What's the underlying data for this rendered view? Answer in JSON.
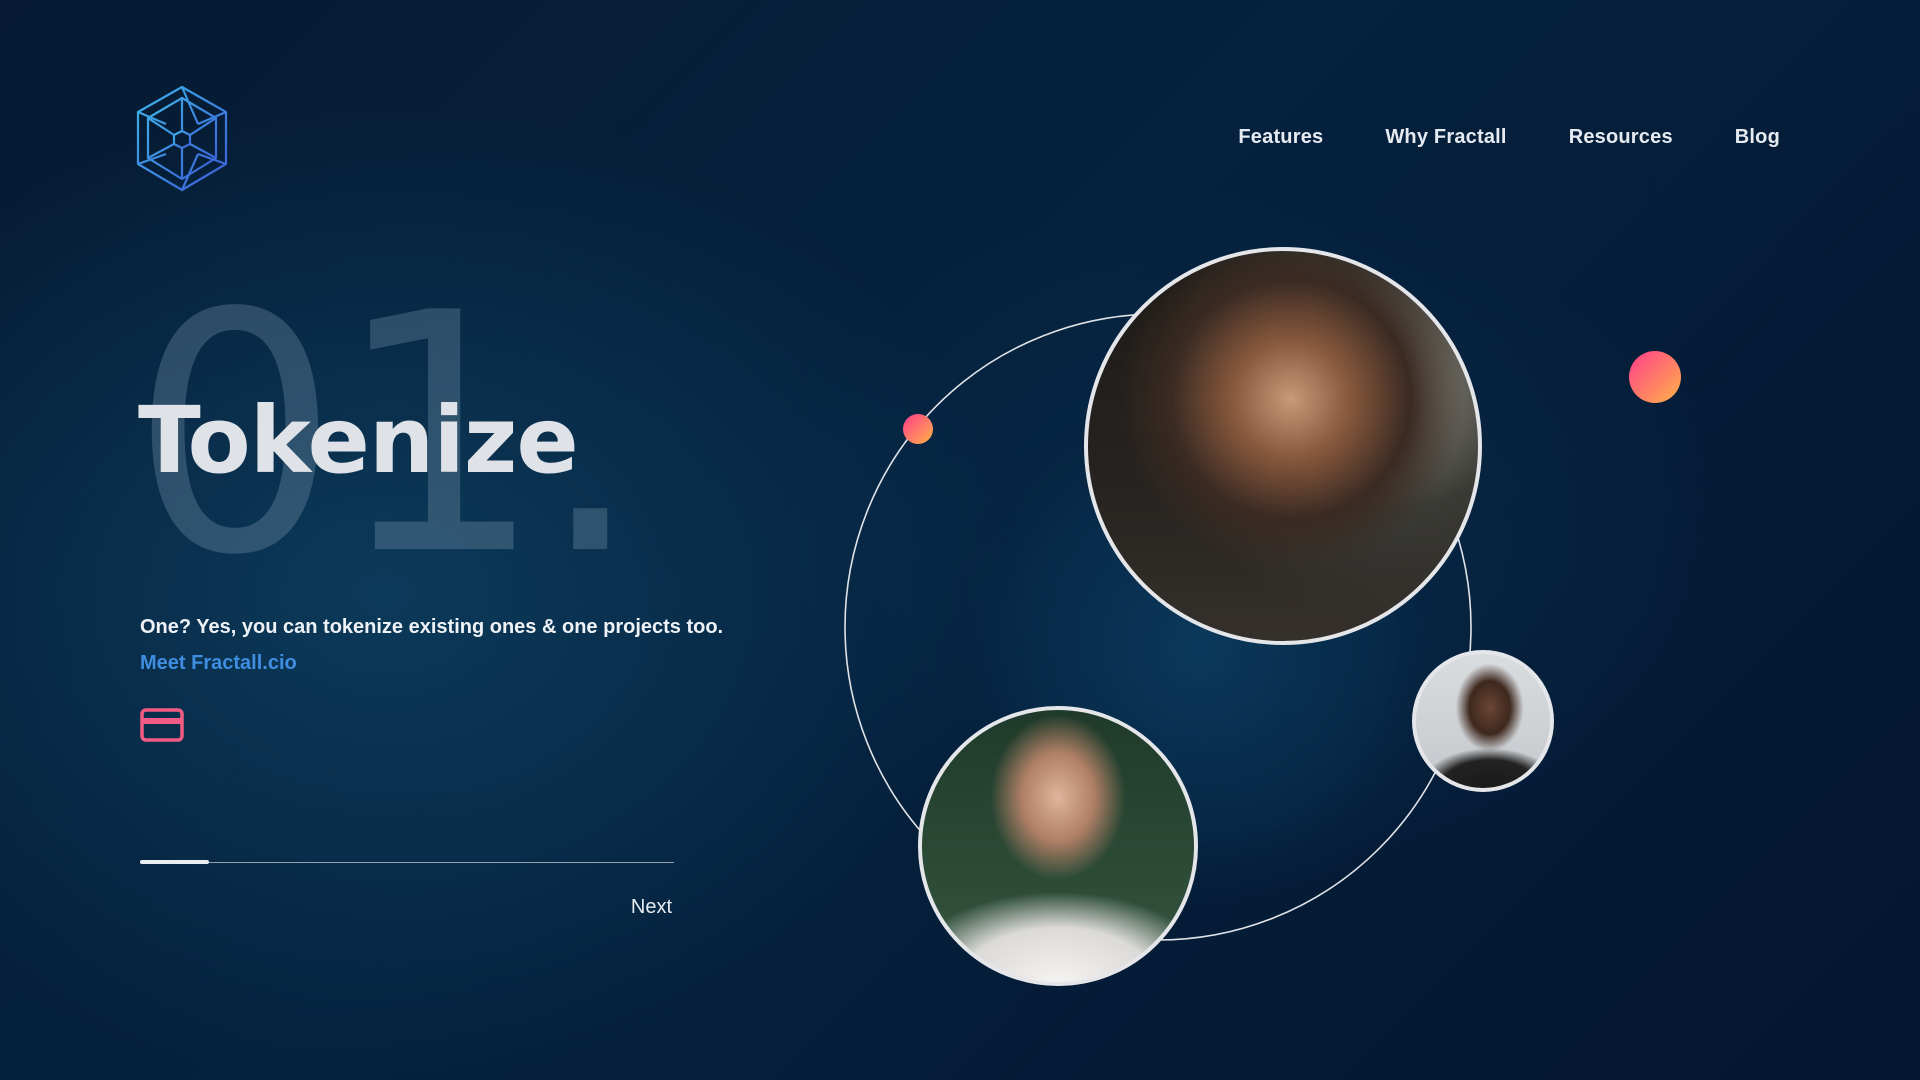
{
  "nav": {
    "items": [
      "Features",
      "Why Fractall",
      "Resources",
      "Blog"
    ]
  },
  "hero": {
    "number": "01.",
    "title": "Tokenize",
    "subtitle": "One?  Yes, you can tokenize existing ones & one projects too.",
    "link_label": "Meet Fractall.cio",
    "next_label": "Next",
    "progress_fraction": 0.13
  },
  "icons": {
    "logo": "hexagon-logo-icon",
    "card": "credit-card-icon"
  },
  "colors": {
    "accent_blue": "#3f8ee0",
    "card_icon": "#f25c84",
    "dot_gradient_start": "#ff3d8b",
    "dot_gradient_end": "#ffb347",
    "ring": "#e4e6ea"
  }
}
